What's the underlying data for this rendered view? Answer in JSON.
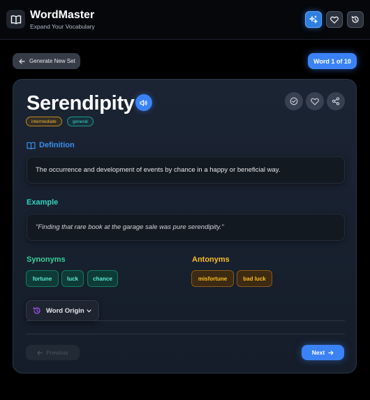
{
  "app": {
    "title": "WordMaster",
    "subtitle": "Expand Your Vocabulary"
  },
  "header_icons": [
    "sparkles-icon",
    "heart-icon",
    "history-icon"
  ],
  "toolbar": {
    "generate_label": "Generate New Set",
    "word_count": "Word 1 of 10"
  },
  "card": {
    "word": "Serendipity",
    "tags": {
      "level": "intermediate",
      "category": "general"
    },
    "definition": {
      "title": "Definition",
      "text": "The occurrence and development of events by chance in a happy or beneficial way."
    },
    "example": {
      "title": "Example",
      "text": "\"Finding that rare book at the garage sale was pure serendipity.\""
    },
    "synonyms": {
      "title": "Synonyms",
      "items": [
        "fortune",
        "luck",
        "chance"
      ]
    },
    "antonyms": {
      "title": "Antonyms",
      "items": [
        "misfortune",
        "bad luck"
      ]
    },
    "origin_label": "Word Origin"
  },
  "nav": {
    "previous_label": "Previous",
    "next_label": "Next"
  },
  "colors": {
    "accent": "#3b82f6",
    "definition": "#3b8ff0",
    "example": "#2dd4bf",
    "synonyms": "#34d399",
    "antonyms": "#fbbf24"
  }
}
